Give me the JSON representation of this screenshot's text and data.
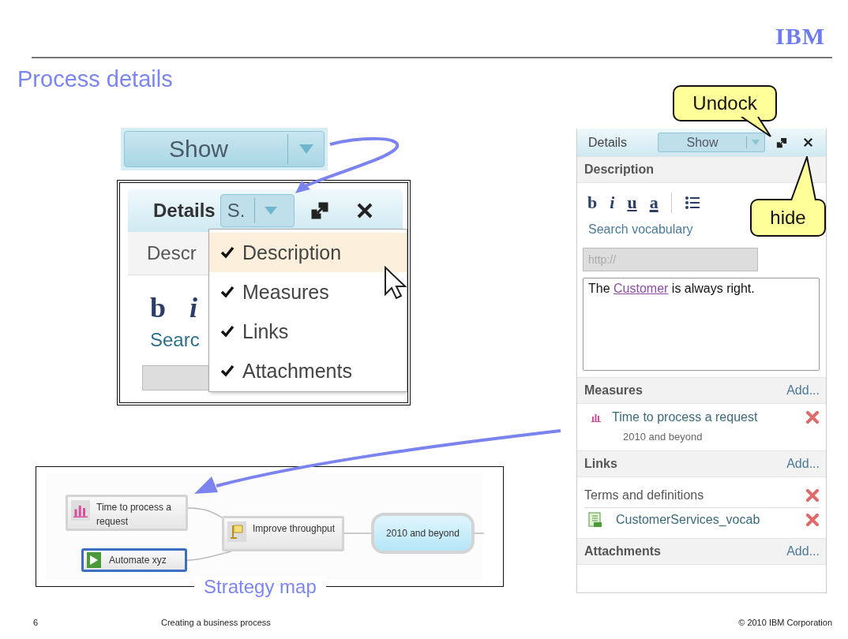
{
  "header": {
    "logo": "IBM",
    "title": "Process details"
  },
  "show_button": {
    "label": "Show"
  },
  "menu_screenshot": {
    "panel_title": "Details",
    "show_label": "S.",
    "section_label": "Descr",
    "format_buttons": [
      "b",
      "i"
    ],
    "search_label": "Searc",
    "menu_items": [
      {
        "label": "Description",
        "checked": true,
        "selected": true
      },
      {
        "label": "Measures",
        "checked": true,
        "selected": false
      },
      {
        "label": "Links",
        "checked": true,
        "selected": false
      },
      {
        "label": "Attachments",
        "checked": true,
        "selected": false
      }
    ]
  },
  "details_panel": {
    "title": "Details",
    "show_label": "Show",
    "description": {
      "heading": "Description",
      "format_buttons": [
        "b",
        "i",
        "u",
        "a"
      ],
      "search_link": "Search vocabulary",
      "url_placeholder": "http://",
      "text_before": "The",
      "text_link": "Customer",
      "text_after": "is always right."
    },
    "measures": {
      "heading": "Measures",
      "add": "Add...",
      "items": [
        {
          "name": "Time to process a request",
          "subtitle": "2010 and beyond"
        }
      ]
    },
    "links": {
      "heading": "Links",
      "add": "Add...",
      "groups": [
        {
          "label": "Terms and definitions",
          "items": [
            {
              "name": "CustomerServices_vocab"
            }
          ]
        }
      ]
    },
    "attachments": {
      "heading": "Attachments",
      "add": "Add..."
    }
  },
  "callouts": [
    {
      "text": "Undock"
    },
    {
      "text": "hide"
    }
  ],
  "strategy_map": {
    "caption": "Strategy map",
    "nodes": [
      {
        "kind": "measure",
        "label": "Time to process a request",
        "selected": false
      },
      {
        "kind": "task",
        "label": "Automate xyz",
        "selected": true
      },
      {
        "kind": "goal",
        "label": "Improve throughput",
        "selected": false
      },
      {
        "kind": "timeframe",
        "label": "2010 and beyond",
        "selected": false
      }
    ]
  },
  "footer": {
    "page": "6",
    "title": "Creating a business process",
    "copyright": "© 2010 IBM Corporation"
  }
}
